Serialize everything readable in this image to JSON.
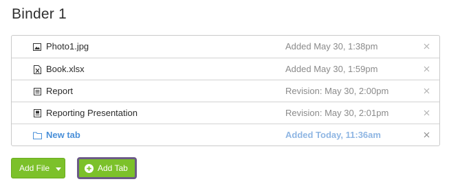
{
  "page": {
    "title": "Binder 1"
  },
  "files": [
    {
      "icon": "image-file-icon",
      "name": "Photo1.jpg",
      "meta": "Added May 30, 1:38pm",
      "active": false
    },
    {
      "icon": "excel-file-icon",
      "name": "Book.xlsx",
      "meta": "Added May 30, 1:59pm",
      "active": false
    },
    {
      "icon": "document-icon",
      "name": "Report",
      "meta": "Revision: May 30, 2:00pm",
      "active": false
    },
    {
      "icon": "presentation-icon",
      "name": "Reporting Presentation",
      "meta": "Revision: May 30, 2:01pm",
      "active": false
    },
    {
      "icon": "folder-icon",
      "name": "New tab",
      "meta": "Added Today, 11:36am",
      "active": true
    }
  ],
  "actions": {
    "add_file_label": "Add File",
    "add_tab_label": "Add Tab"
  },
  "colors": {
    "accent_green": "#7cc12a",
    "link_blue": "#4a90d9",
    "focus_outline": "#6b5a86"
  }
}
